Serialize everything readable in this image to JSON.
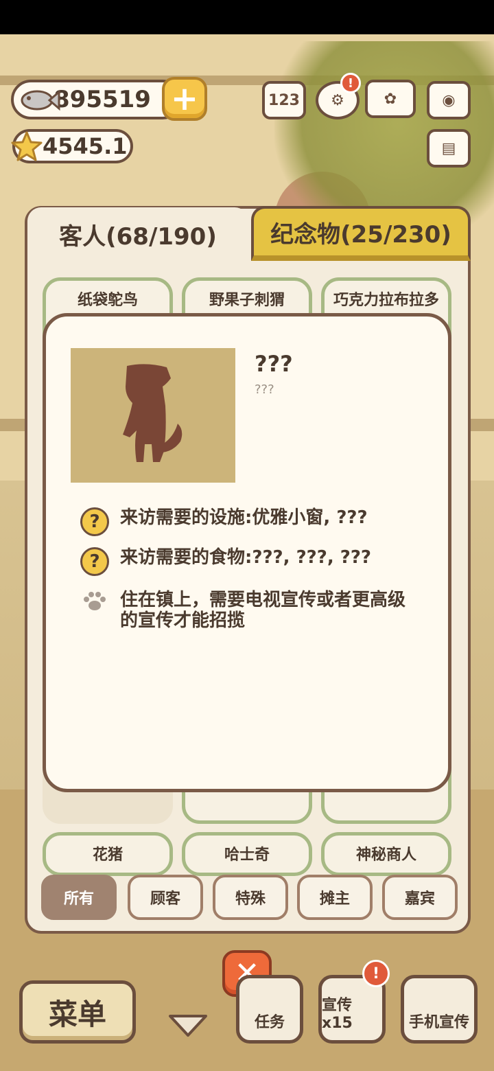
{
  "currency": {
    "fish": "895519",
    "stars": "4545.1"
  },
  "top_icons": {
    "ranking": "123",
    "alert_badge": "!"
  },
  "tabs": [
    {
      "label": "客人(68/190)",
      "active": true
    },
    {
      "label": "纪念物(25/230)",
      "active": false
    }
  ],
  "guest_cards": [
    "纸袋鸵鸟",
    "野果子刺猬",
    "巧克力拉布拉多",
    "花猪",
    "哈士奇",
    "神秘商人"
  ],
  "popup": {
    "name": "???",
    "subtitle": "???",
    "facilities": "来访需要的设施:优雅小窗, ???",
    "food": "来访需要的食物:???, ???, ???",
    "note": "住在镇上，需要电视宣传或者更高级的宣传才能招揽",
    "q_glyph": "?"
  },
  "filters": [
    {
      "label": "所有",
      "active": true
    },
    {
      "label": "顾客",
      "active": false
    },
    {
      "label": "特殊",
      "active": false
    },
    {
      "label": "摊主",
      "active": false
    },
    {
      "label": "嘉宾",
      "active": false
    }
  ],
  "bottom": {
    "menu": "菜单",
    "tasks": "任务",
    "promo": "宣传x15",
    "phone_promo": "手机宣传",
    "alert_badge": "!"
  },
  "colors": {
    "accent_yellow": "#e5c343",
    "close_red": "#ee6a3a",
    "panel_border": "#7a5a47",
    "card_border_green": "#a7b984"
  }
}
